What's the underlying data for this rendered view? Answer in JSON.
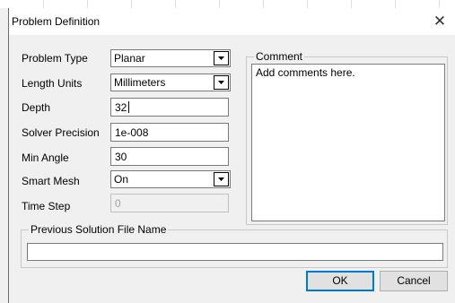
{
  "dialog": {
    "title": "Problem Definition",
    "close_glyph": "✕"
  },
  "fields": {
    "problem_type": {
      "label": "Problem Type",
      "value": "Planar"
    },
    "length_units": {
      "label": "Length Units",
      "value": "Millimeters"
    },
    "depth": {
      "label": "Depth",
      "value": "32"
    },
    "solver_precision": {
      "label": "Solver Precision",
      "value": "1e-008"
    },
    "min_angle": {
      "label": "Min Angle",
      "value": "30"
    },
    "smart_mesh": {
      "label": "Smart Mesh",
      "value": "On"
    },
    "time_step": {
      "label": "Time Step",
      "value": "0",
      "disabled": true
    }
  },
  "comment": {
    "label": "Comment",
    "value": "Add comments here."
  },
  "previous_solution": {
    "label": "Previous Solution File Name",
    "value": ""
  },
  "buttons": {
    "ok": "OK",
    "cancel": "Cancel"
  }
}
